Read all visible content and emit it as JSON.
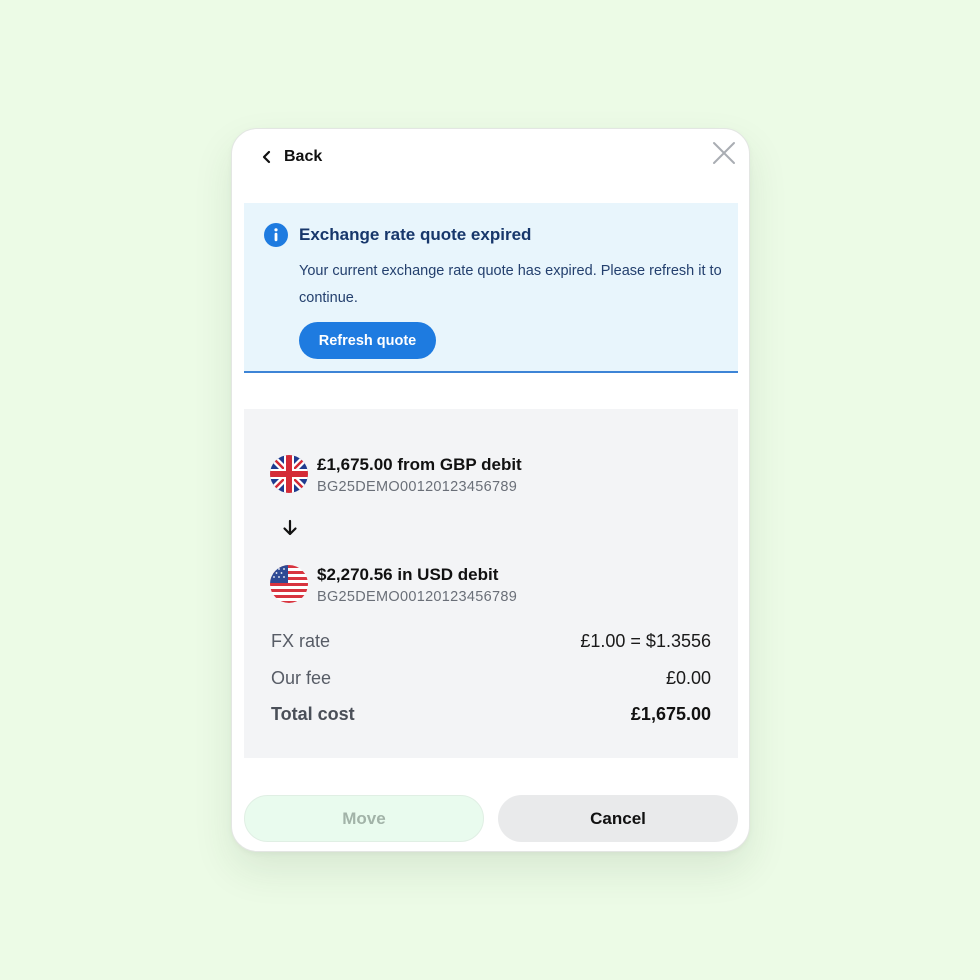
{
  "header": {
    "back_label": "Back",
    "back_icon": "chevron-left-icon",
    "close_icon": "close-icon"
  },
  "alert": {
    "icon": "info-icon",
    "title": "Exchange rate quote expired",
    "body": "Your current exchange rate quote has expired. Please refresh it to continue.",
    "refresh_label": "Refresh quote",
    "colors": {
      "background": "#e8f5fc",
      "accent": "#1e7be0",
      "title": "#17376b"
    }
  },
  "transfer": {
    "from": {
      "flag": "uk-flag-icon",
      "title": "£1,675.00 from GBP debit",
      "account": "BG25DEMO00120123456789"
    },
    "direction_icon": "arrow-down-icon",
    "to": {
      "flag": "us-flag-icon",
      "title": "$2,270.56 in USD debit",
      "account": "BG25DEMO00120123456789"
    }
  },
  "details": {
    "fx_rate_label": "FX rate",
    "fx_rate_value": "£1.00 = $1.3556",
    "fee_label": "Our fee",
    "fee_value": "£0.00",
    "total_label": "Total cost",
    "total_value": "£1,675.00"
  },
  "actions": {
    "move_label": "Move",
    "move_disabled": true,
    "cancel_label": "Cancel"
  }
}
